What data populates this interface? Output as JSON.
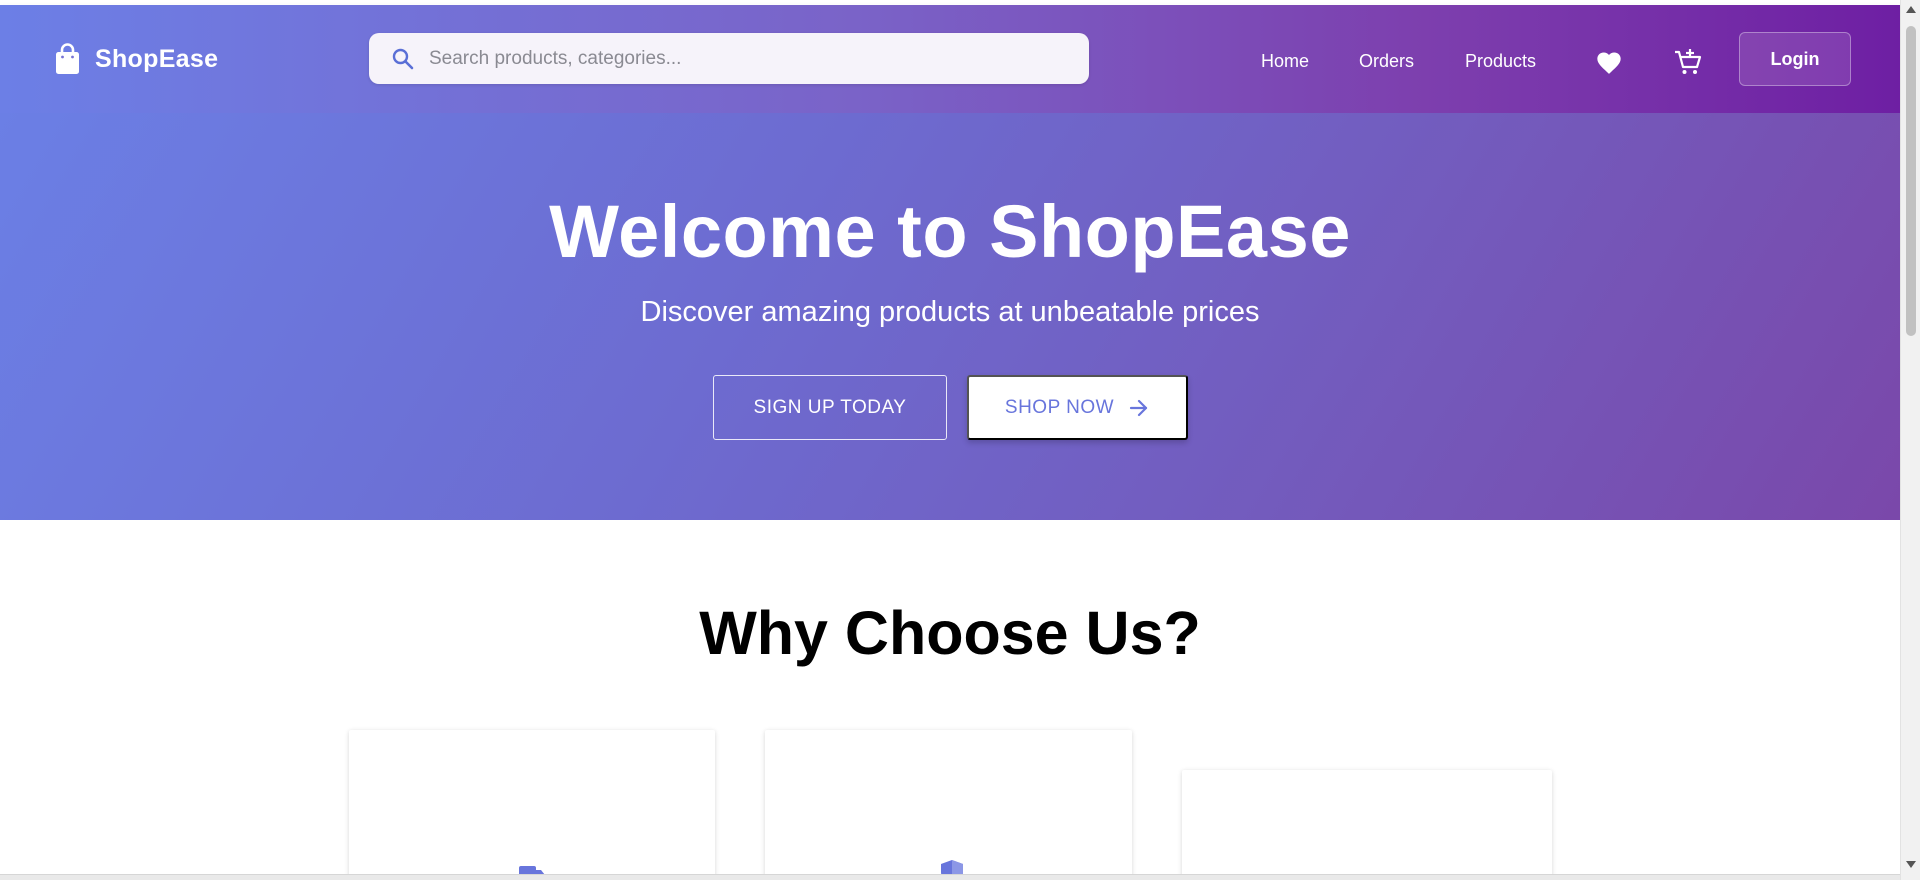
{
  "brand": {
    "name": "ShopEase",
    "icon": "shopping-bag-icon"
  },
  "search": {
    "placeholder": "Search products, categories...",
    "value": "",
    "icon": "search-icon"
  },
  "nav": {
    "links": [
      "Home",
      "Orders",
      "Products"
    ],
    "icons": [
      "heart-icon",
      "add-to-cart-icon"
    ],
    "login_label": "Login"
  },
  "hero": {
    "title": "Welcome to ShopEase",
    "subtitle": "Discover amazing products at unbeatable prices",
    "signup_label": "SIGN UP TODAY",
    "shop_label": "SHOP NOW",
    "shop_icon": "arrow-right-icon"
  },
  "features": {
    "title": "Why Choose Us?",
    "card_icons": [
      "truck-icon",
      "shield-icon",
      ""
    ]
  },
  "colors": {
    "nav_gradient_start": "#6c7fe6",
    "nav_gradient_end": "#6e1fa3",
    "hero_gradient_start": "#6b7fe5",
    "hero_gradient_end": "#7a48aa",
    "accent": "#6875dc",
    "white": "#ffffff"
  }
}
